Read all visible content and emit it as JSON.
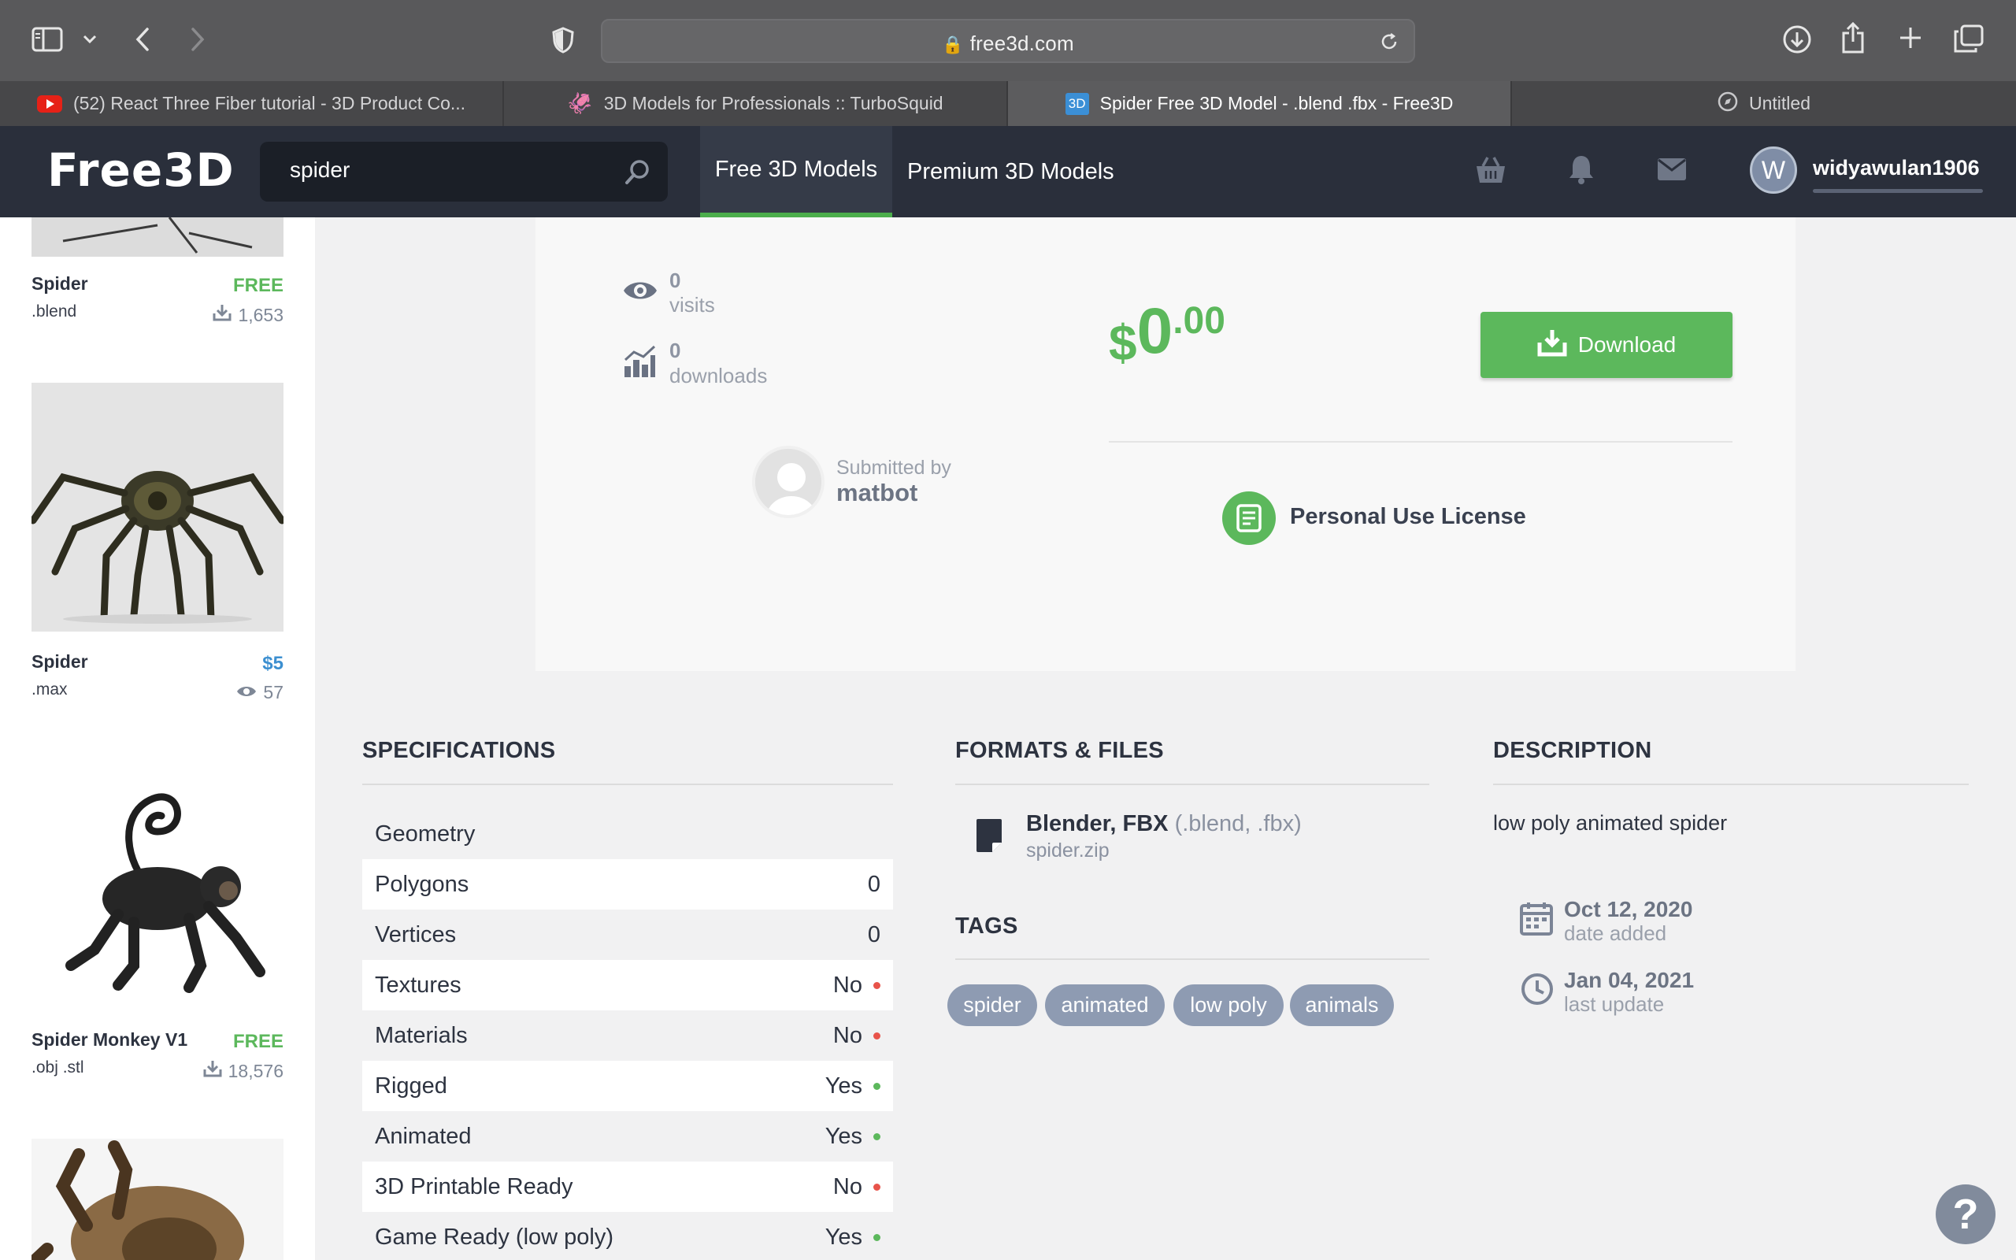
{
  "browser": {
    "url": "free3d.com",
    "tabs": [
      {
        "label": "(52) React Three Fiber tutorial - 3D Product Co...",
        "icon": "youtube-icon",
        "active": false
      },
      {
        "label": "3D Models for Professionals :: TurboSquid",
        "icon": "turbosquid-icon",
        "active": false
      },
      {
        "label": "Spider Free 3D Model - .blend .fbx - Free3D",
        "icon": "free3d-icon",
        "favicon_text": "3D",
        "active": true
      },
      {
        "label": "Untitled",
        "icon": "compass-icon",
        "active": false
      }
    ]
  },
  "site": {
    "logo": "Free3D",
    "search_value": "spider",
    "nav": {
      "free": "Free 3D Models",
      "premium": "Premium 3D Models"
    },
    "user": {
      "initial": "W",
      "name": "widyawulan1906"
    }
  },
  "sidebar": {
    "models": [
      {
        "name": "Spider",
        "format": ".blend",
        "price": "FREE",
        "stat": "1,653",
        "stat_icon": "download-icon",
        "price_color": "#5cb85c"
      },
      {
        "name": "Spider",
        "format": ".max",
        "price": "$5",
        "stat": "57",
        "stat_icon": "eye-icon",
        "price_color": "#3c8fd0"
      },
      {
        "name": "Spider Monkey V1",
        "format": ".obj .stl",
        "price": "FREE",
        "stat": "18,576",
        "stat_icon": "download-icon",
        "price_color": "#5cb85c"
      }
    ]
  },
  "card": {
    "visits_count": "0",
    "visits_label": "visits",
    "downloads_count": "0",
    "downloads_label": "downloads",
    "price_symbol": "$",
    "price_main": "0",
    "price_cents": ".00",
    "download_label": "Download",
    "submitted_by_label": "Submitted by",
    "submitter": "matbot",
    "license": "Personal Use License"
  },
  "specifications": {
    "title": "SPECIFICATIONS",
    "rows": [
      {
        "label": "Geometry",
        "value": ""
      },
      {
        "label": "Polygons",
        "value": "0"
      },
      {
        "label": "Vertices",
        "value": "0"
      },
      {
        "label": "Textures",
        "value": "No",
        "status": "no"
      },
      {
        "label": "Materials",
        "value": "No",
        "status": "no"
      },
      {
        "label": "Rigged",
        "value": "Yes",
        "status": "yes"
      },
      {
        "label": "Animated",
        "value": "Yes",
        "status": "yes"
      },
      {
        "label": "3D Printable Ready",
        "value": "No",
        "status": "no"
      },
      {
        "label": "Game Ready (low poly)",
        "value": "Yes",
        "status": "yes"
      }
    ]
  },
  "formats": {
    "title": "FORMATS & FILES",
    "name": "Blender, FBX",
    "extensions": "(.blend, .fbx)",
    "file": "spider.zip"
  },
  "tags": {
    "title": "TAGS",
    "items": [
      "spider",
      "animated",
      "low poly",
      "animals"
    ]
  },
  "description": {
    "title": "DESCRIPTION",
    "text": "low poly animated spider",
    "date_added": "Oct 12, 2020",
    "date_added_label": "date added",
    "last_update": "Jan 04, 2021",
    "last_update_label": "last update"
  },
  "colors": {
    "accent_green": "#5cb85c",
    "status_no": "#e8534a",
    "status_yes": "#5cb85c",
    "nav_bg": "#2a2f3b"
  }
}
